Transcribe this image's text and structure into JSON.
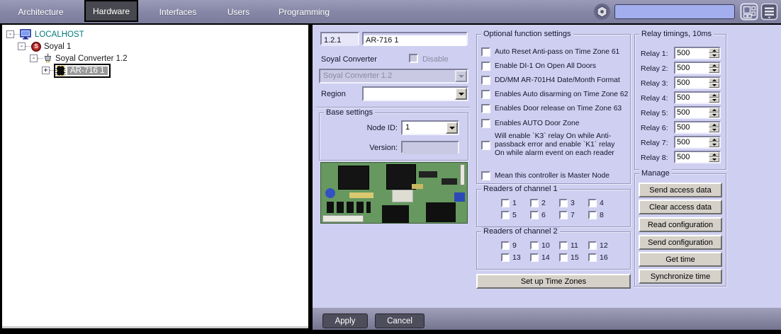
{
  "colors": {
    "topbar": "#8d8dad",
    "panel_bg": "#cfcff1",
    "search_bg": "#a2aeee",
    "selection_bg": "#9a9a9a",
    "active_tab_bg": "#47474f",
    "pcb_green": "#66985f"
  },
  "topbar": {
    "tabs": [
      {
        "label": "Architecture"
      },
      {
        "label": "Hardware"
      },
      {
        "label": "Interfaces"
      },
      {
        "label": "Users"
      },
      {
        "label": "Programming"
      }
    ],
    "active_tab": "Hardware",
    "search_value": "",
    "icons": [
      "gear-icon",
      "grid-view-icon",
      "menu-icon"
    ]
  },
  "tree": {
    "items": [
      {
        "label": "LOCALHOST",
        "icon": "computer-icon",
        "expander": "-"
      },
      {
        "label": "Soyal 1",
        "icon": "soyal-module-icon",
        "expander": "-",
        "badge": "S"
      },
      {
        "label": "Soyal Converter 1.2",
        "icon": "converter-icon",
        "expander": "-"
      },
      {
        "label": "AR-716 1",
        "icon": "controller-chip-icon",
        "expander": "+",
        "selected": true
      }
    ]
  },
  "panel": {
    "id_value": "1.2.1",
    "name_value": "AR-716 1",
    "type_label": "Soyal Converter",
    "disable_label": "Disable",
    "parent_value": "Soyal Converter 1.2",
    "region_label": "Region",
    "region_value": "",
    "base": {
      "title": "Base settings",
      "node_id_label": "Node ID:",
      "node_id_value": "1",
      "version_label": "Version:",
      "version_value": ""
    },
    "optional": {
      "title": "Optional function settings",
      "items": [
        "Auto Reset Anti-pass on Time Zone 61",
        "Enable DI-1 On Open All Doors",
        "DD/MM AR-701H4 Date/Month Format",
        "Enables Auto disarming on Time Zone 62",
        "Enables Door release on Time Zone 63",
        "Enables AUTO Door  Zone",
        "Will enable `K3` relay On while Anti-passback error and enable `K1` relay On while alarm event on each reader",
        "Mean this controller is Master Node"
      ]
    },
    "readers1": {
      "title": "Readers of channel 1",
      "options": [
        "1",
        "2",
        "3",
        "4",
        "5",
        "6",
        "7",
        "8"
      ]
    },
    "readers2": {
      "title": "Readers of channel 2",
      "options": [
        "9",
        "10",
        "11",
        "12",
        "13",
        "14",
        "15",
        "16"
      ]
    },
    "timezones_button": "Set up Time Zones",
    "relays": {
      "title": "Relay timings, 10ms",
      "items": [
        {
          "label": "Relay 1:",
          "value": "500"
        },
        {
          "label": "Relay 2:",
          "value": "500"
        },
        {
          "label": "Relay 3:",
          "value": "500"
        },
        {
          "label": "Relay 4:",
          "value": "500"
        },
        {
          "label": "Relay 5:",
          "value": "500"
        },
        {
          "label": "Relay 6:",
          "value": "500"
        },
        {
          "label": "Relay 7:",
          "value": "500"
        },
        {
          "label": "Relay 8:",
          "value": "500"
        }
      ]
    },
    "manage": {
      "title": "Manage",
      "buttons": [
        "Send access data",
        "Clear access data",
        "Read configuration",
        "Send configuration",
        "Get time",
        "Synchronize time"
      ]
    }
  },
  "footer": {
    "apply_label": "Apply",
    "cancel_label": "Cancel"
  }
}
